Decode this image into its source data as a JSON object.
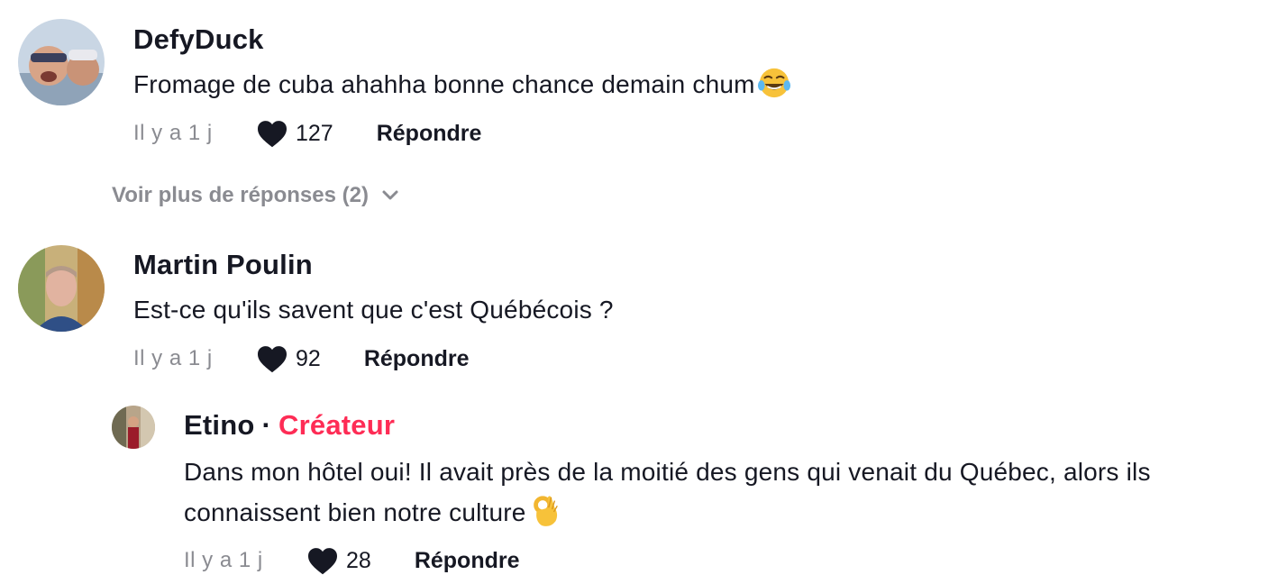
{
  "comments": [
    {
      "username": "DefyDuck",
      "text": "Fromage de cuba ahahha bonne chance demain chum",
      "emoji": "tears-of-joy-emoji",
      "time": "Il y a 1 j",
      "likes": "127",
      "reply_label": "Répondre",
      "more_replies_label": "Voir plus de réponses (2)"
    },
    {
      "username": "Martin Poulin",
      "text": "Est-ce qu'ils savent que c'est Québécois ?",
      "time": "Il y a 1 j",
      "likes": "92",
      "reply_label": "Répondre",
      "replies": [
        {
          "username": "Etino",
          "creator_label": "Créateur",
          "text_line1": "Dans mon hôtel oui! Il avait près de la moitié des gens qui venait du Québec, alors ils",
          "text_line2": "connaissent bien notre culture",
          "emoji": "ok-hand-emoji",
          "time": "Il y a 1 j",
          "likes": "28",
          "reply_label": "Répondre"
        }
      ]
    }
  ],
  "colors": {
    "text": "#161823",
    "muted": "#8a8b91",
    "creator": "#fe2c55"
  }
}
